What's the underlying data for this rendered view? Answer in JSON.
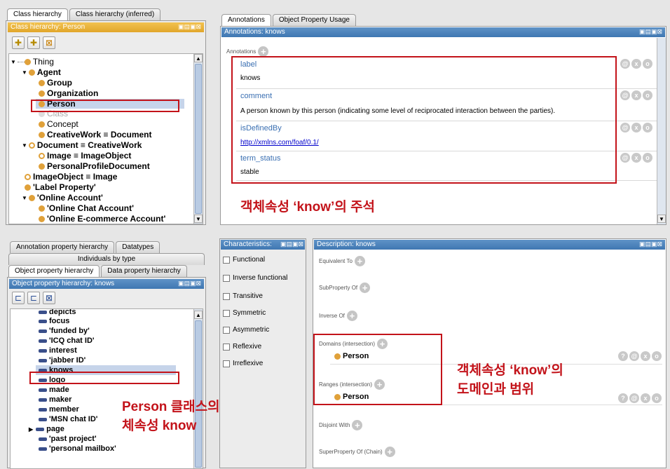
{
  "class_panel": {
    "tabs": [
      "Class hierarchy",
      "Class hierarchy (inferred)"
    ],
    "title": "Class hierarchy: Person",
    "tree": [
      {
        "label": "Thing",
        "bold": false
      },
      {
        "label": "Agent",
        "bold": true
      },
      {
        "label": "Group",
        "bold": true
      },
      {
        "label": "Organization",
        "bold": true
      },
      {
        "label": "Person",
        "bold": true
      },
      {
        "label": "Class",
        "bold": false
      },
      {
        "label": "Concept",
        "bold": false
      },
      {
        "label": "CreativeWork ≡ Document",
        "bold": true
      },
      {
        "label": "Document ≡ CreativeWork",
        "bold": true
      },
      {
        "label": "Image ≡ ImageObject",
        "bold": true
      },
      {
        "label": "PersonalProfileDocument",
        "bold": true
      },
      {
        "label": "ImageObject ≡ Image",
        "bold": true
      },
      {
        "label": "'Label Property'",
        "bold": true
      },
      {
        "label": "'Online Account'",
        "bold": true
      },
      {
        "label": "'Online Chat Account'",
        "bold": true
      },
      {
        "label": "'Online E-commerce Account'",
        "bold": true
      }
    ]
  },
  "annotations_panel": {
    "tabs": [
      "Annotations",
      "Object Property Usage"
    ],
    "title": "Annotations: knows",
    "header": "Annotations",
    "rows": [
      {
        "key": "label",
        "value": "knows"
      },
      {
        "key": "comment",
        "value": "A person known by this person (indicating some level of reciprocated interaction between the parties)."
      },
      {
        "key": "isDefinedBy",
        "value": "http://xmlns.com/foaf/0.1/"
      },
      {
        "key": "term_status",
        "value": "stable"
      }
    ],
    "callout": "객체속성 ‘know’의 주석"
  },
  "property_panel": {
    "tabs_row1": [
      "Annotation property hierarchy",
      "Datatypes"
    ],
    "tabs_row2": [
      "Individuals by type"
    ],
    "tabs_row3": [
      "Object property hierarchy",
      "Data property hierarchy"
    ],
    "title": "Object property hierarchy: knows",
    "items": [
      "depicts",
      "focus",
      "'funded by'",
      "'ICQ chat ID'",
      "interest",
      "'jabber ID'",
      "knows",
      "logo",
      "made",
      "maker",
      "member",
      "'MSN chat ID'",
      "page",
      "'past project'",
      "'personal mailbox'"
    ],
    "callout_line1": "Person 클래스의 객",
    "callout_line2": "체속성 know"
  },
  "characteristics_panel": {
    "title": "Characteristics:",
    "items": [
      "Functional",
      "Inverse functional",
      "Transitive",
      "Symmetric",
      "Asymmetric",
      "Reflexive",
      "Irreflexive"
    ]
  },
  "description_panel": {
    "title": "Description: knows",
    "sections": {
      "equivalent": "Equivalent To",
      "subproperty": "SubProperty Of",
      "inverse": "Inverse Of",
      "domains": "Domains (intersection)",
      "ranges": "Ranges (intersection)",
      "disjoint": "Disjoint With",
      "superproperty": "SuperProperty Of (Chain)"
    },
    "domain_value": "Person",
    "range_value": "Person",
    "callout_line1": "객체속성 ‘know’의",
    "callout_line2": "도메인과 범위"
  },
  "icons": {
    "help": "?",
    "edit": "@",
    "delete": "x",
    "info": "o",
    "plus": "+"
  }
}
